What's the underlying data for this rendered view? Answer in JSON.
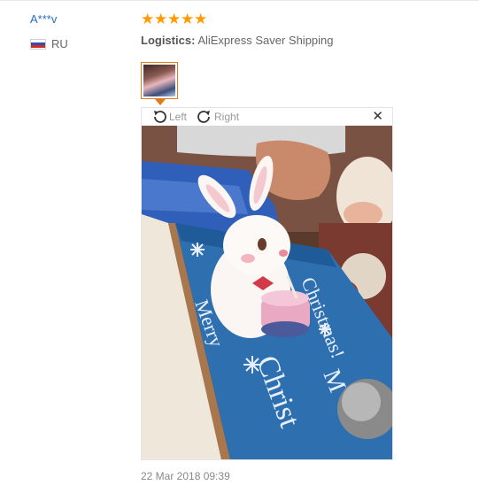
{
  "review": {
    "user_name": "A***v",
    "country": "RU",
    "rating": 5,
    "stars": [
      "★",
      "★",
      "★",
      "★",
      "★"
    ],
    "logistics_label": "Logistics:",
    "logistics_value": "AliExpress Saver Shipping",
    "date": "22 Mar 2018 09:39"
  },
  "viewer": {
    "rotate_left_label": "Left",
    "rotate_right_label": "Right",
    "close_glyph": "✕",
    "photo_text": {
      "christmas": "Christmas!",
      "merry": "Merry",
      "christmas2": "Christ",
      "merry2": "M"
    }
  },
  "colors": {
    "star": "#ff9a00",
    "username_link": "#2d6cc0",
    "thumb_border": "#e07a1a"
  },
  "icons": {
    "flag": "russia-flag-icon",
    "rotate_left": "rotate-left-icon",
    "rotate_right": "rotate-right-icon",
    "close": "close-icon"
  }
}
